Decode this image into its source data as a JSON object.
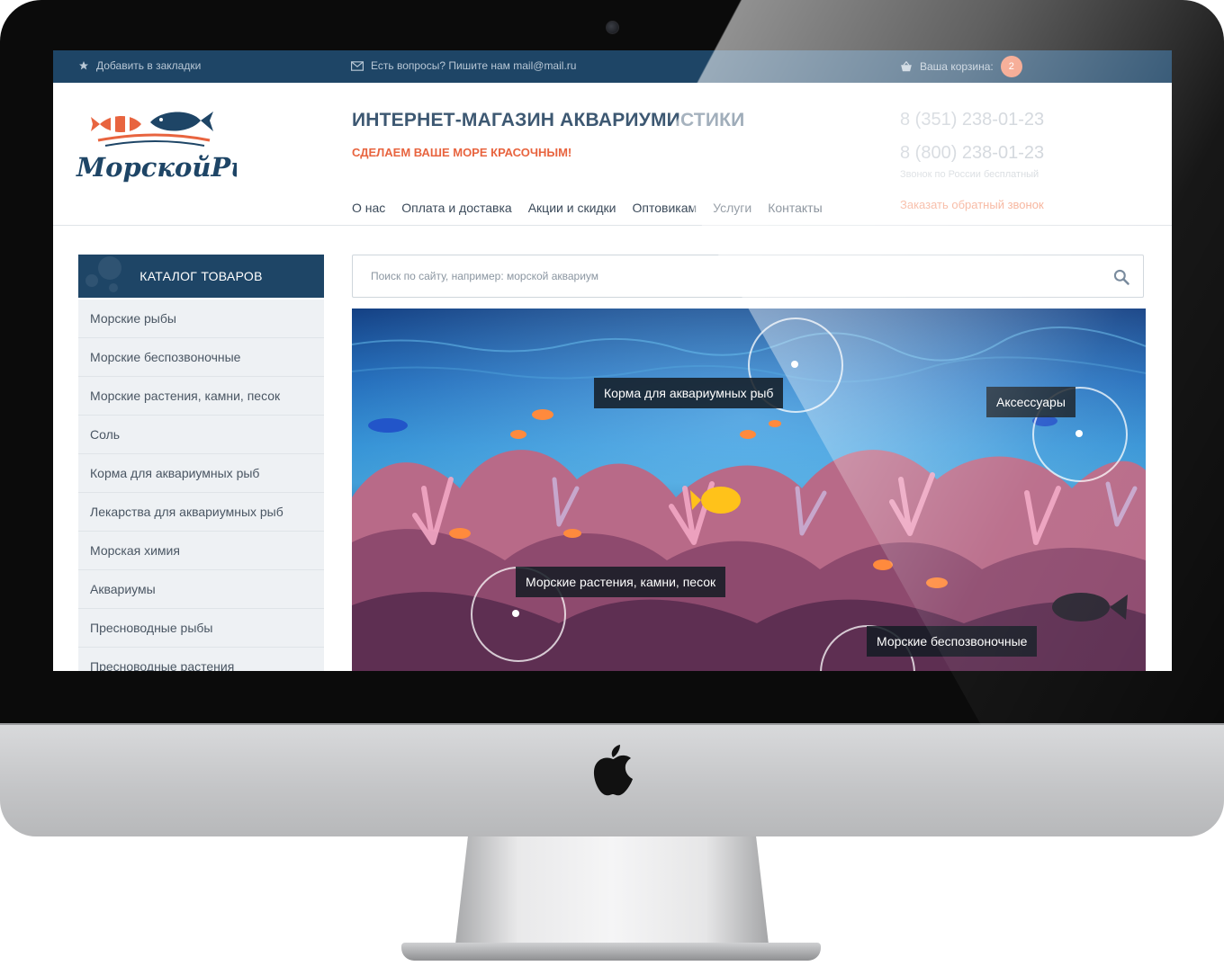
{
  "topbar": {
    "bookmark": "Добавить в закладки",
    "questions": "Есть вопросы? Пишите нам mail@mail.ru",
    "cart_label": "Ваша корзина:",
    "cart_count": "2"
  },
  "header": {
    "logo_text": "МорскойРиф",
    "title": "ИНТЕРНЕТ-МАГАЗИН АКВАРИУМИСТИКИ",
    "slogan": "СДЕЛАЕМ ВАШЕ МОРЕ КРАСОЧНЫМ!",
    "phone1": "8 (351) 238-01-23",
    "phone2": "8 (800) 238-01-23",
    "phone_note": "Звонок по России бесплатный",
    "callback": "Заказать обратный звонок"
  },
  "nav": [
    "О нас",
    "Оплата и доставка",
    "Акции и скидки",
    "Оптовикам",
    "Услуги",
    "Контакты"
  ],
  "catalog": {
    "title": "КАТАЛОГ ТОВАРОВ",
    "items": [
      "Морские рыбы",
      "Морские беспозвоночные",
      "Морские растения, камни, песок",
      "Соль",
      "Корма для аквариумных рыб",
      "Лекарства для аквариумных рыб",
      "Морская химия",
      "Аквариумы",
      "Пресноводные рыбы",
      "Пресноводные растения"
    ]
  },
  "search": {
    "placeholder": "Поиск по сайту, например: морской аквариум"
  },
  "banner": {
    "hotspots": [
      "Корма для аквариумных рыб",
      "Аксессуары",
      "Морские растения, камни, песок",
      "Морские беспозвоночные"
    ]
  },
  "colors": {
    "brand_navy": "#1e4566",
    "accent_coral": "#e8643f",
    "badge": "#f38d6e"
  }
}
